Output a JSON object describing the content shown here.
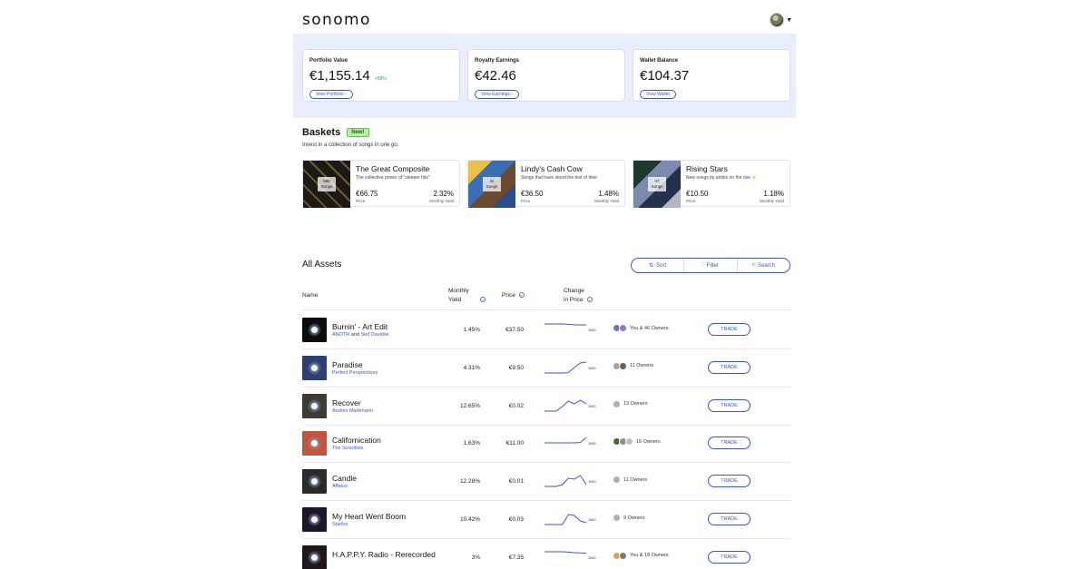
{
  "header": {
    "logo": "sonomo",
    "profile_icon": "user-avatar",
    "caret_icon": "caret-down-icon"
  },
  "summary": [
    {
      "label": "Portfolio Value",
      "value": "€1,155.14",
      "delta": "+58%",
      "button": "View Portfolio  ›",
      "delta_color": "#2fa84f"
    },
    {
      "label": "Royalty Earnings",
      "value": "€42.46",
      "delta": "",
      "button": "View Earnings  ›"
    },
    {
      "label": "Wallet Balance",
      "value": "€104.37",
      "delta": "",
      "button": "View Wallet"
    }
  ],
  "baskets": {
    "title": "Baskets",
    "badge": "New!",
    "subtitle": "Invest in a collection of songs in one go.",
    "items": [
      {
        "name": "The Great Composite",
        "description": "The collective power of \"sleeper hits\"",
        "price": "€66.75",
        "price_label": "Price",
        "yield": "2.32%",
        "yield_label": "Monthly Yield",
        "count": "585",
        "count_label": "Songs"
      },
      {
        "name": "Lindy's Cash Cow",
        "description": "Songs that have stood the test of time",
        "price": "€36.50",
        "price_label": "Price",
        "yield": "1.48%",
        "yield_label": "Monthly Yield",
        "count": "42",
        "count_label": "Songs"
      },
      {
        "name": "Rising Stars",
        "description": "New songs by artists on the rise ⚡",
        "price": "€10.50",
        "price_label": "Price",
        "yield": "1.18%",
        "yield_label": "Monthly Yield",
        "count": "47",
        "count_label": "Songs"
      }
    ]
  },
  "assets": {
    "title": "All Assets",
    "toolbar": {
      "sort": "Sort",
      "filter": "Filter",
      "search": "Search"
    },
    "columns": {
      "name": "Name",
      "yield_1": "Monthly",
      "yield_2": "Yield",
      "price": "Price",
      "change_1": "Change",
      "change_2": "in Price"
    },
    "timeframe": "1MO",
    "trade_label": "TRADE",
    "rows": [
      {
        "title": "Burnin' - Art Edit",
        "artist_a": "ANOTR",
        "sep": " and ",
        "artist_b": "Stef Davidse",
        "yield": "1.45%",
        "price": "€37.50",
        "owners": "You & 46 Owners",
        "spark": [
          0.8,
          0.8,
          0.8,
          0.8,
          0.78,
          0.75,
          0.75,
          0.75
        ],
        "thumb": "#0c0c0c",
        "avatars": [
          "#6c7a95",
          "#9a6fd6"
        ]
      },
      {
        "title": "Paradise",
        "artist_a": "Perfect Perspectives",
        "sep": "",
        "artist_b": "",
        "yield": "4.31%",
        "price": "€9.50",
        "owners": "11 Owners",
        "spark": [
          0.2,
          0.2,
          0.2,
          0.2,
          0.22,
          0.5,
          0.75,
          0.8
        ],
        "thumb": "#2c3e74",
        "avatars": [
          "#a4a4a4",
          "#7d5a4a"
        ]
      },
      {
        "title": "Recover",
        "artist_a": "Andres Markmann",
        "sep": "",
        "artist_b": "",
        "yield": "12.65%",
        "price": "€0.02",
        "owners": "13 Owners",
        "spark": [
          0.2,
          0.2,
          0.2,
          0.45,
          0.75,
          0.6,
          0.8,
          0.6
        ],
        "thumb": "#3f3a33",
        "avatars": [
          "#b0b0b0"
        ]
      },
      {
        "title": "Californication",
        "artist_a": "The Scientists",
        "sep": "",
        "artist_b": "",
        "yield": "1.63%",
        "price": "€11.00",
        "owners": "16 Owners",
        "spark": [
          0.5,
          0.5,
          0.5,
          0.5,
          0.5,
          0.5,
          0.52,
          0.8
        ],
        "thumb": "#c4553a",
        "avatars": [
          "#3f6b3d",
          "#8f8f8f",
          "#c0c0c0"
        ]
      },
      {
        "title": "Candle",
        "artist_a": "Affatus",
        "sep": "",
        "artist_b": "",
        "yield": "12.28%",
        "price": "€0.01",
        "owners": "11 Owners",
        "spark": [
          0.2,
          0.2,
          0.2,
          0.3,
          0.65,
          0.6,
          0.8,
          0.3
        ],
        "thumb": "#2a2a2a",
        "avatars": [
          "#b0b0b0"
        ]
      },
      {
        "title": "My Heart Went Boom",
        "artist_a": "Starfox",
        "sep": "",
        "artist_b": "",
        "yield": "10.42%",
        "price": "€0.03",
        "owners": "9 Owners",
        "spark": [
          0.2,
          0.2,
          0.2,
          0.2,
          0.75,
          0.7,
          0.4,
          0.3
        ],
        "thumb": "#1b1628",
        "avatars": [
          "#b0b0b0"
        ]
      },
      {
        "title": "H.A.P.P.Y. Radio - Rerecorded",
        "artist_a": "",
        "sep": "",
        "artist_b": "",
        "yield": "3%",
        "price": "€7.35",
        "owners": "You & 18 Owners",
        "spark": [
          0.8,
          0.8,
          0.8,
          0.8,
          0.78,
          0.75,
          0.74,
          0.72
        ],
        "thumb": "#201818",
        "avatars": [
          "#d9a45b",
          "#7a7a7a"
        ]
      }
    ]
  },
  "colors": {
    "accent": "#3a56d4",
    "band": "#e8eefb",
    "positive": "#2fa84f"
  }
}
